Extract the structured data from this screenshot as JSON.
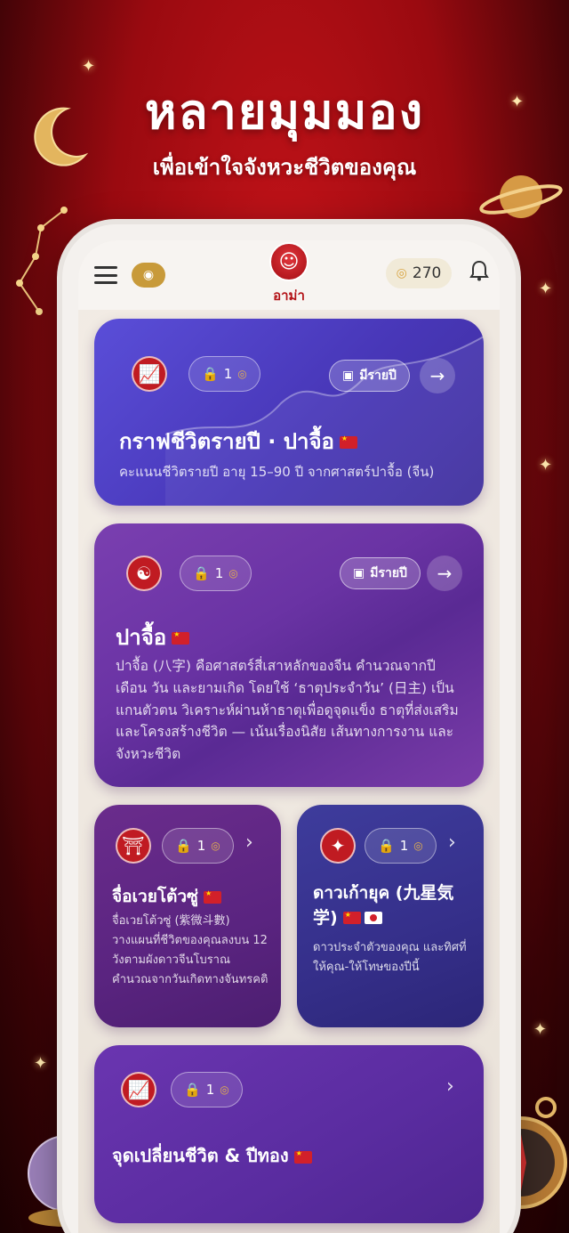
{
  "headline": "หลายมุมมอง",
  "subheadline": "เพื่อเข้าใจจังหวะชีวิตของคุณ",
  "app": {
    "logo_label": "อาม่า",
    "coins": "270"
  },
  "icons": {
    "menu": "menu-icon",
    "badge": "medal-icon",
    "coin": "coin-icon",
    "bell": "bell-icon",
    "lock": "lock-icon",
    "calendar": "calendar-icon",
    "arrow": "arrow-right-icon",
    "chevron": "chevron-right-icon"
  },
  "cards": [
    {
      "title": "กราฟชีวิตรายปี · ปาจื้อ",
      "cost": "1",
      "tag": "มีรายปี",
      "desc": "คะแนนชีวิตรายปี อายุ 15–90 ปี จากศาสตร์ปาจื้อ (จีน)",
      "icon": "chart-icon"
    },
    {
      "title": "ปาจื้อ",
      "cost": "1",
      "tag": "มีรายปี",
      "desc": "ปาจื้อ (八字) คือศาสตร์สี่เสาหลักของจีน คำนวณจากปี เดือน วัน และยามเกิด โดยใช้ ‘ธาตุประจำวัน’ (日主) เป็นแกนตัวตน วิเคราะห์ผ่านห้าธาตุเพื่อดูจุดแข็ง ธาตุที่ส่งเสริม และโครงสร้างชีวิต — เน้นเรื่องนิสัย เส้นทางการงาน และจังหวะชีวิต",
      "icon": "yin-yang-icon"
    },
    {
      "title": "จื่อเวยโต้วซู่",
      "cost": "1",
      "desc": "จื่อเวยโต้วซู่ (紫微斗數) วางแผนที่ชีวิตของคุณลงบน 12 วังตามผังดาวจีนโบราณ คำนวณจากวันเกิดทางจันทรคติ",
      "icon": "temple-icon"
    },
    {
      "title": "ดาวเก้ายุค (九星気学)",
      "cost": "1",
      "desc": "ดาวประจำตัวของคุณ และทิศที่ให้คุณ-ให้โทษของปีนี้",
      "icon": "star-icon"
    },
    {
      "title": "จุดเปลี่ยนชีวิต & ปีทอง",
      "cost": "1",
      "icon": "chart-icon"
    }
  ]
}
